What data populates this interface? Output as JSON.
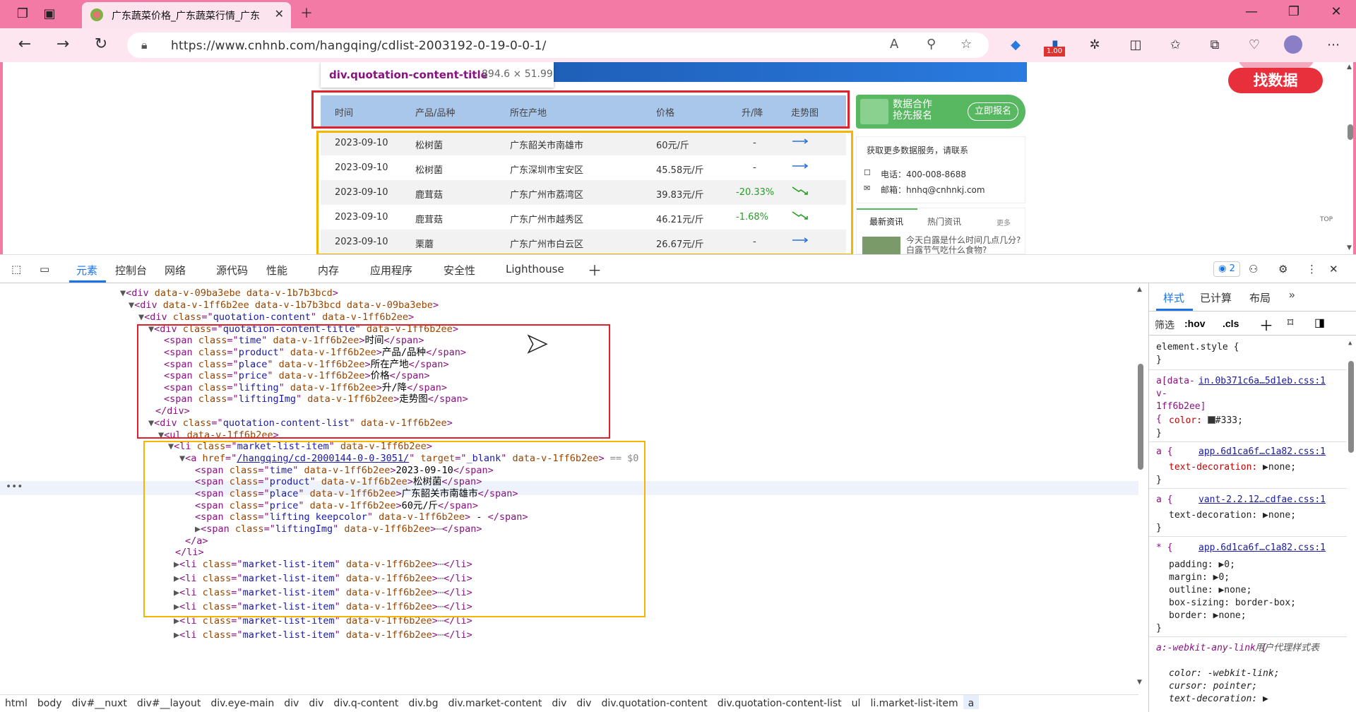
{
  "browser": {
    "tab_title": "广东蔬菜价格_广东蔬菜行情_广东",
    "url": "https://www.cnhnb.com/hangqing/cdlist-2003192-0-19-0-0-1/",
    "ext_badge": "1.00",
    "icons": [
      "workspaces-icon",
      "tab-actions-icon",
      "close-tab-icon",
      "new-tab-icon",
      "minimize-icon",
      "restore-icon",
      "close-window-icon",
      "back-icon",
      "forward-icon",
      "refresh-icon",
      "lock-icon",
      "read-aloud-icon",
      "zoom-icon",
      "favorite-icon",
      "extensions-icon",
      "split-icon",
      "favorites-icon",
      "collections-icon",
      "performance-icon",
      "profile-icon",
      "more-icon"
    ]
  },
  "page": {
    "tooltip": {
      "selector": "div.quotation-content-title",
      "dims": "894.6 × 51.99"
    },
    "headers": [
      "时间",
      "产品/品种",
      "所在产地",
      "价格",
      "升/降",
      "走势图"
    ],
    "rows": [
      {
        "time": "2023-09-10",
        "product": "松树菌",
        "place": "广东韶关市南雄市",
        "price": "60元/斤",
        "change": "-",
        "trend": "flat"
      },
      {
        "time": "2023-09-10",
        "product": "松树菌",
        "place": "广东深圳市宝安区",
        "price": "45.58元/斤",
        "change": "-",
        "trend": "flat"
      },
      {
        "time": "2023-09-10",
        "product": "鹿茸菇",
        "place": "广东广州市荔湾区",
        "price": "39.83元/斤",
        "change": "-20.33%",
        "trend": "down"
      },
      {
        "time": "2023-09-10",
        "product": "鹿茸菇",
        "place": "广东广州市越秀区",
        "price": "46.21元/斤",
        "change": "-1.68%",
        "trend": "down"
      },
      {
        "time": "2023-09-10",
        "product": "栗蘑",
        "place": "广东广州市白云区",
        "price": "26.67元/斤",
        "change": "-",
        "trend": "flat"
      }
    ],
    "ad": {
      "line1": "数据合作",
      "line2": "抢先报名",
      "button": "立即报名"
    },
    "find_data": "找数据",
    "contact": {
      "title": "获取更多数据服务，请联系",
      "phone": "电话：400-008-8688",
      "email": "邮箱：hnhq@cnhnkj.com"
    },
    "news": {
      "tab1": "最新资讯",
      "tab2": "热门资讯",
      "more": "更多",
      "headline": "今天白露是什么时间几点几分?",
      "headline2": "白露节气吃什么食物?"
    },
    "top": "TOP",
    "colors": {
      "highlight_red": "#e0202a",
      "highlight_yellow": "#f4b400",
      "header_bg": "#a9c7ea",
      "down_green": "#22a022",
      "titlebar": "#f47aa6"
    }
  },
  "devtools": {
    "tabs": [
      "元素",
      "控制台",
      "网络",
      "源代码",
      "性能",
      "内存",
      "应用程序",
      "安全性",
      "Lighthouse"
    ],
    "issues_count": "2",
    "dom": [
      "<div data-v-09ba3ebe data-v-1b7b3bcd>",
      "<div data-v-1ff6b2ee data-v-1b7b3bcd data-v-09ba3ebe>",
      "<div class=\"quotation-content\" data-v-1ff6b2ee>",
      "<div class=\"quotation-content-title\" data-v-1ff6b2ee>",
      "<span class=\"time\" data-v-1ff6b2ee>时间</span>",
      "<span class=\"product\" data-v-1ff6b2ee>产品/品种</span>",
      "<span class=\"place\" data-v-1ff6b2ee>所在产地</span>",
      "<span class=\"price\" data-v-1ff6b2ee>价格</span>",
      "<span class=\"lifting\" data-v-1ff6b2ee>升/降</span>",
      "<span class=\"liftingImg\" data-v-1ff6b2ee>走势图</span>",
      "</div>",
      "<div class=\"quotation-content-list\" data-v-1ff6b2ee>",
      "<ul data-v-1ff6b2ee>",
      "<li class=\"market-list-item\" data-v-1ff6b2ee>",
      "<a href=\"/hangqing/cd-2000144-0-0-3051/\" target=\"_blank\" data-v-1ff6b2ee> == $0",
      "<span class=\"time\" data-v-1ff6b2ee>2023-09-10</span>",
      "<span class=\"product\" data-v-1ff6b2ee>松树菌</span>",
      "<span class=\"place\" data-v-1ff6b2ee>广东韶关市南雄市</span>",
      "<span class=\"price\" data-v-1ff6b2ee>60元/斤</span>",
      "<span class=\"lifting keepcolor\" data-v-1ff6b2ee> - </span>",
      "<span class=\"liftingImg\" data-v-1ff6b2ee>",
      "</span>",
      "</a>",
      "</li>",
      "<li class=\"market-list-item\" data-v-1ff6b2ee>",
      "</li>"
    ],
    "breadcrumbs": [
      "html",
      "body",
      "div#__nuxt",
      "div#__layout",
      "div.eye-main",
      "div",
      "div",
      "div.q-content",
      "div.bg",
      "div.market-content",
      "div",
      "div",
      "div.quotation-content",
      "div.quotation-content-list",
      "ul",
      "li.market-list-item",
      "a"
    ],
    "styles": {
      "tabs": [
        "样式",
        "已计算",
        "布局"
      ],
      "filter_label": "筛选",
      "hov": ":hov",
      "cls": ".cls",
      "element_style": "element.style {",
      "r1_sel": "a[data-v-1ff6b2ee] {",
      "r1_src": "in.0b371c6a…5d1eb.css:1",
      "r1_prop": "color:",
      "r1_val": "#333;",
      "r2_sel": "a {",
      "r2_src": "app.6d1ca6f…c1a82.css:1",
      "r2_prop": "text-decoration:",
      "r2_val": "none;",
      "r3_sel": "a {",
      "r3_src": "vant-2.2.12…cdfae.css:1",
      "r3_prop": "text-decoration:",
      "r3_val": "none;",
      "r4_sel": "* {",
      "r4_src": "app.6d1ca6f…c1a82.css:1",
      "r4_props": [
        "padding: ▶0;",
        "margin: ▶0;",
        "outline: ▶none;",
        "box-sizing: border-box;",
        "border: ▶none;"
      ],
      "ua_sel": "a:-webkit-any-link {",
      "ua_label": "用户代理样式表",
      "ua_props": [
        "color: -webkit-link;",
        "cursor: pointer;",
        "text-decoration: ▶"
      ]
    }
  }
}
